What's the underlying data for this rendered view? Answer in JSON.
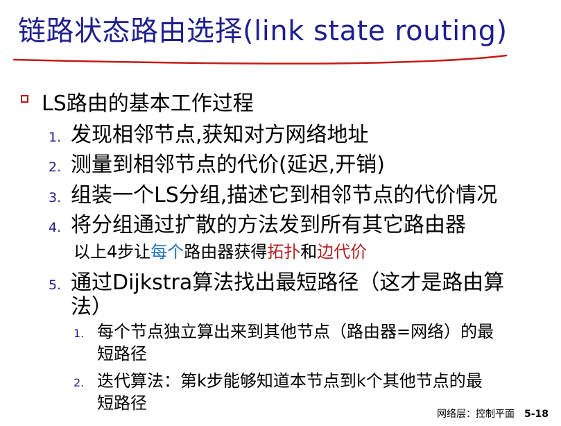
{
  "title": "链路状态路由选择(link state routing)",
  "heading": "LS路由的基本工作过程",
  "steps": [
    {
      "num": "1.",
      "text": "发现相邻节点,获知对方网络地址"
    },
    {
      "num": "2.",
      "text": "测量到相邻节点的代价(延迟,开销)"
    },
    {
      "num": "3.",
      "text": "组装一个LS分组,描述它到相邻节点的代价情况"
    },
    {
      "num": "4.",
      "text": "将分组通过扩散的方法发到所有其它路由器"
    }
  ],
  "note": {
    "prefix": "以上4步让",
    "every": "每个",
    "middle": "路由器获得",
    "topology": "拓扑",
    "and": "和",
    "edge_cost": "边代价"
  },
  "step5": {
    "num": "5.",
    "line1": "通过Dijkstra算法找出最短路径（这才是路由算",
    "line2": "法）"
  },
  "sub": [
    {
      "num": "1.",
      "line1": "每个节点独立算出来到其他节点（路由器=网络）的最",
      "line2": "短路径"
    },
    {
      "num": "2.",
      "line1": "迭代算法：第k步能够知道本节点到k个其他节点的最",
      "line2": "短路径"
    }
  ],
  "footer": {
    "label": "网络层：控制平面",
    "page": "5-18"
  }
}
